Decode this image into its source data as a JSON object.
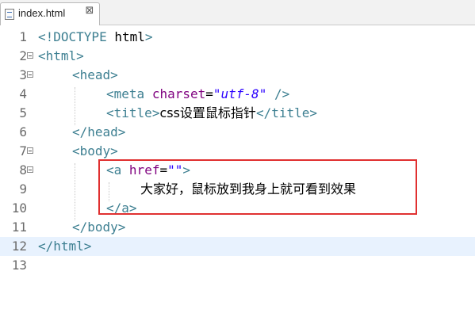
{
  "editor": {
    "tab": {
      "label": "index.html",
      "close_glyph": "⊠"
    },
    "lines": [
      {
        "num": "1",
        "segments": [
          [
            "tag",
            "<!"
          ],
          [
            "tname",
            "DOCTYPE"
          ],
          [
            "txt",
            " html"
          ],
          [
            "tag",
            ">"
          ]
        ]
      },
      {
        "num": "2",
        "segments": [
          [
            "tag",
            "<"
          ],
          [
            "tname",
            "html"
          ],
          [
            "tag",
            ">"
          ]
        ]
      },
      {
        "num": "3",
        "segments": [
          [
            "tag",
            "<"
          ],
          [
            "tname",
            "head"
          ],
          [
            "tag",
            ">"
          ]
        ]
      },
      {
        "num": "4",
        "segments": [
          [
            "tag",
            "<"
          ],
          [
            "tname",
            "meta"
          ],
          [
            "txt",
            " "
          ],
          [
            "attr",
            "charset"
          ],
          [
            "txt",
            "="
          ],
          [
            "aval",
            "\"utf-8\""
          ],
          [
            "txt",
            " "
          ],
          [
            "tag",
            "/>"
          ]
        ]
      },
      {
        "num": "5",
        "segments": [
          [
            "tag",
            "<"
          ],
          [
            "tname",
            "title"
          ],
          [
            "tag",
            ">"
          ],
          [
            "cjk",
            "css设置鼠标指针"
          ],
          [
            "tag",
            "</"
          ],
          [
            "tname",
            "title"
          ],
          [
            "tag",
            ">"
          ]
        ]
      },
      {
        "num": "6",
        "segments": [
          [
            "tag",
            "</"
          ],
          [
            "tname",
            "head"
          ],
          [
            "tag",
            ">"
          ]
        ]
      },
      {
        "num": "7",
        "segments": [
          [
            "tag",
            "<"
          ],
          [
            "tname",
            "body"
          ],
          [
            "tag",
            ">"
          ]
        ]
      },
      {
        "num": "8",
        "segments": [
          [
            "tag",
            "<"
          ],
          [
            "tname",
            "a"
          ],
          [
            "txt",
            " "
          ],
          [
            "attr",
            "href"
          ],
          [
            "txt",
            "="
          ],
          [
            "aval",
            "\"\""
          ],
          [
            "tag",
            ">"
          ]
        ]
      },
      {
        "num": "9",
        "segments": [
          [
            "cjk",
            "大家好，鼠标放到我身上就可看到效果"
          ]
        ]
      },
      {
        "num": "10",
        "segments": [
          [
            "tag",
            "</"
          ],
          [
            "tname",
            "a"
          ],
          [
            "tag",
            ">"
          ]
        ]
      },
      {
        "num": "11",
        "segments": [
          [
            "tag",
            "</"
          ],
          [
            "tname",
            "body"
          ],
          [
            "tag",
            ">"
          ]
        ]
      },
      {
        "num": "12",
        "segments": [
          [
            "tag",
            "</"
          ],
          [
            "tname",
            "html"
          ],
          [
            "tag",
            ">"
          ]
        ]
      },
      {
        "num": "13",
        "segments": []
      }
    ],
    "current_line": 12,
    "highlight_color": "#e03030"
  }
}
